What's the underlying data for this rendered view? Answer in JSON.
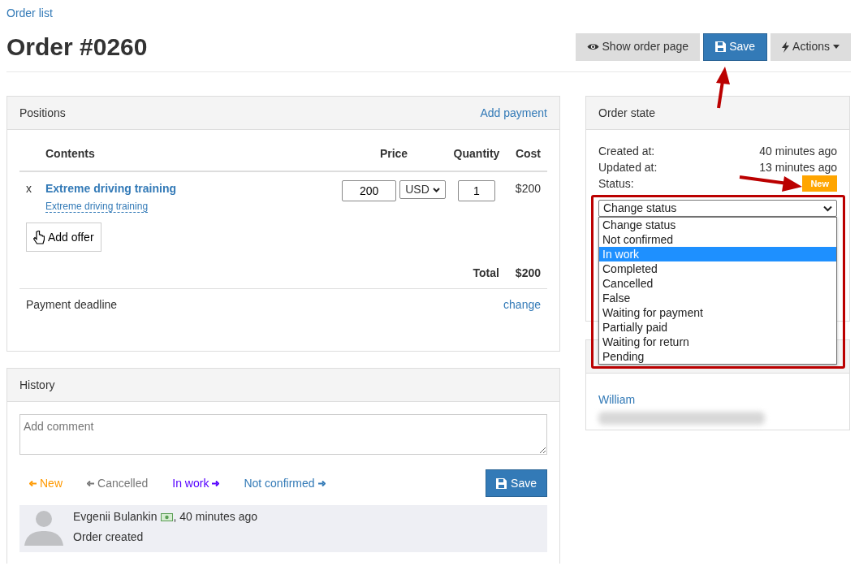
{
  "breadcrumb": "Order list",
  "title": "Order #0260",
  "header_buttons": [
    {
      "kind": "view",
      "label": "Show order page"
    },
    {
      "kind": "save",
      "label": "Save"
    },
    {
      "kind": "actions",
      "label": "Actions"
    }
  ],
  "positions": {
    "title": "Positions",
    "header_link": "Add payment",
    "columns": [
      "Contents",
      "Price",
      "Quantity",
      "Cost"
    ],
    "rows": [
      {
        "remove": "x",
        "name": "Extreme driving training",
        "subtitle": "Extreme driving training",
        "price": "200",
        "currency": "USD",
        "quantity": "1",
        "cost": "$200"
      }
    ],
    "add_offer": "Add offer",
    "total_label": "Total",
    "total": "$200",
    "deadline_label": "Payment deadline",
    "deadline_link": "change"
  },
  "order_state": {
    "title": "Order state",
    "fields": [
      {
        "label": "Created at:",
        "value": "40 minutes ago"
      },
      {
        "label": "Updated at:",
        "value": "13 minutes ago"
      }
    ],
    "status_label": "Status:",
    "status_badge": "New",
    "status_select": "Change status",
    "options": [
      {
        "label": "Change status",
        "selected": false
      },
      {
        "label": "Not confirmed",
        "selected": false
      },
      {
        "label": "In work",
        "selected": true
      },
      {
        "label": "Completed",
        "selected": false
      },
      {
        "label": "Cancelled",
        "selected": false
      },
      {
        "label": "False",
        "selected": false
      },
      {
        "label": "Waiting for payment",
        "selected": false
      },
      {
        "label": "Partially paid",
        "selected": false
      },
      {
        "label": "Waiting for return",
        "selected": false
      },
      {
        "label": "Pending",
        "selected": false
      }
    ]
  },
  "customer": {
    "name": "William"
  },
  "history": {
    "title": "History",
    "comment_placeholder": "Add comment",
    "transitions": [
      {
        "label": "New",
        "kind": "back",
        "color": "#ff9900"
      },
      {
        "label": "Cancelled",
        "kind": "back",
        "color": "#777777"
      },
      {
        "label": "In work",
        "kind": "forward",
        "color": "#5500ff"
      },
      {
        "label": "Not confirmed",
        "kind": "forward",
        "color": "#337ab7"
      }
    ],
    "save": "Save",
    "entries": [
      {
        "author": "Evgenii Bulankin",
        "time": ", 40 minutes ago",
        "text": "Order created"
      }
    ]
  }
}
